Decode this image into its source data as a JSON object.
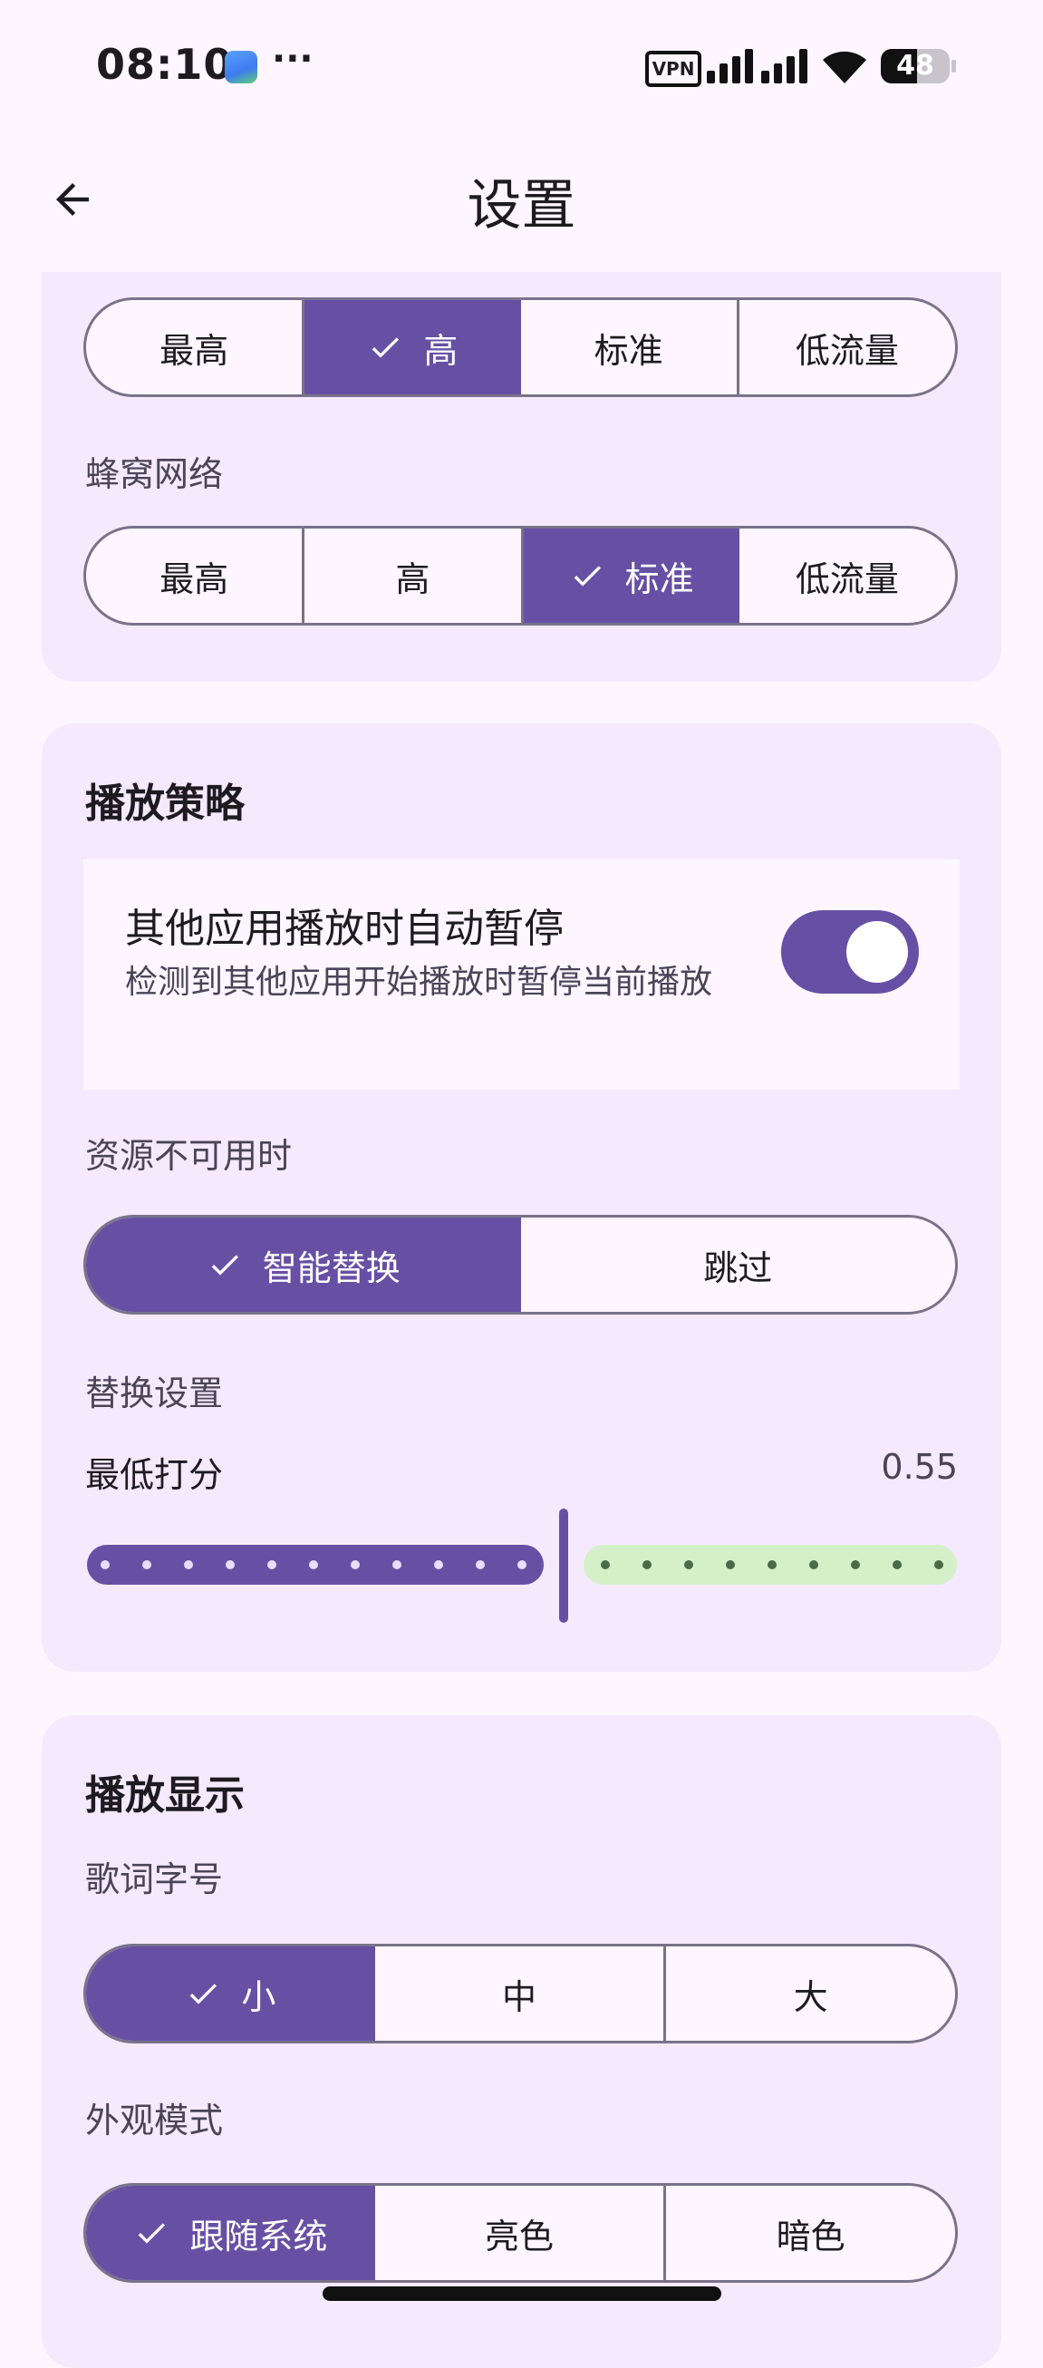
{
  "status_bar": {
    "time": "08:10",
    "more": "···",
    "vpn": "VPN",
    "battery": "48",
    "icons": [
      "app-notification-icon",
      "vpn-icon",
      "cellular-signal-icon",
      "wifi-icon",
      "battery-icon"
    ]
  },
  "header": {
    "back_icon": "arrow-left-icon",
    "title": "设置"
  },
  "quality": {
    "wifi_options": [
      "最高",
      "高",
      "标准",
      "低流量"
    ],
    "wifi_selected": 1,
    "cellular_label": "蜂窝网络",
    "cellular_options": [
      "最高",
      "高",
      "标准",
      "低流量"
    ],
    "cellular_selected": 2
  },
  "playback_strategy": {
    "title": "播放策略",
    "auto_pause": {
      "title": "其他应用播放时自动暂停",
      "subtitle": "检测到其他应用开始播放时暂停当前播放",
      "enabled": true
    },
    "unavailable_label": "资源不可用时",
    "unavailable_options": [
      "智能替换",
      "跳过"
    ],
    "unavailable_selected": 0,
    "replace_label": "替换设置",
    "min_score_label": "最低打分",
    "min_score_value": "0.55",
    "slider": {
      "value": 0.55,
      "min": 0,
      "max": 1,
      "steps": 20
    }
  },
  "display": {
    "title": "播放显示",
    "lyrics_label": "歌词字号",
    "lyrics_options": [
      "小",
      "中",
      "大"
    ],
    "lyrics_selected": 0,
    "appearance_label": "外观模式",
    "appearance_options": [
      "跟随系统",
      "亮色",
      "暗色"
    ],
    "appearance_selected": 0
  },
  "colors": {
    "primary": "#6750a4",
    "card": "#f5e9fd",
    "background": "#fdf6ff",
    "slider_inactive": "#d3f0c8"
  }
}
